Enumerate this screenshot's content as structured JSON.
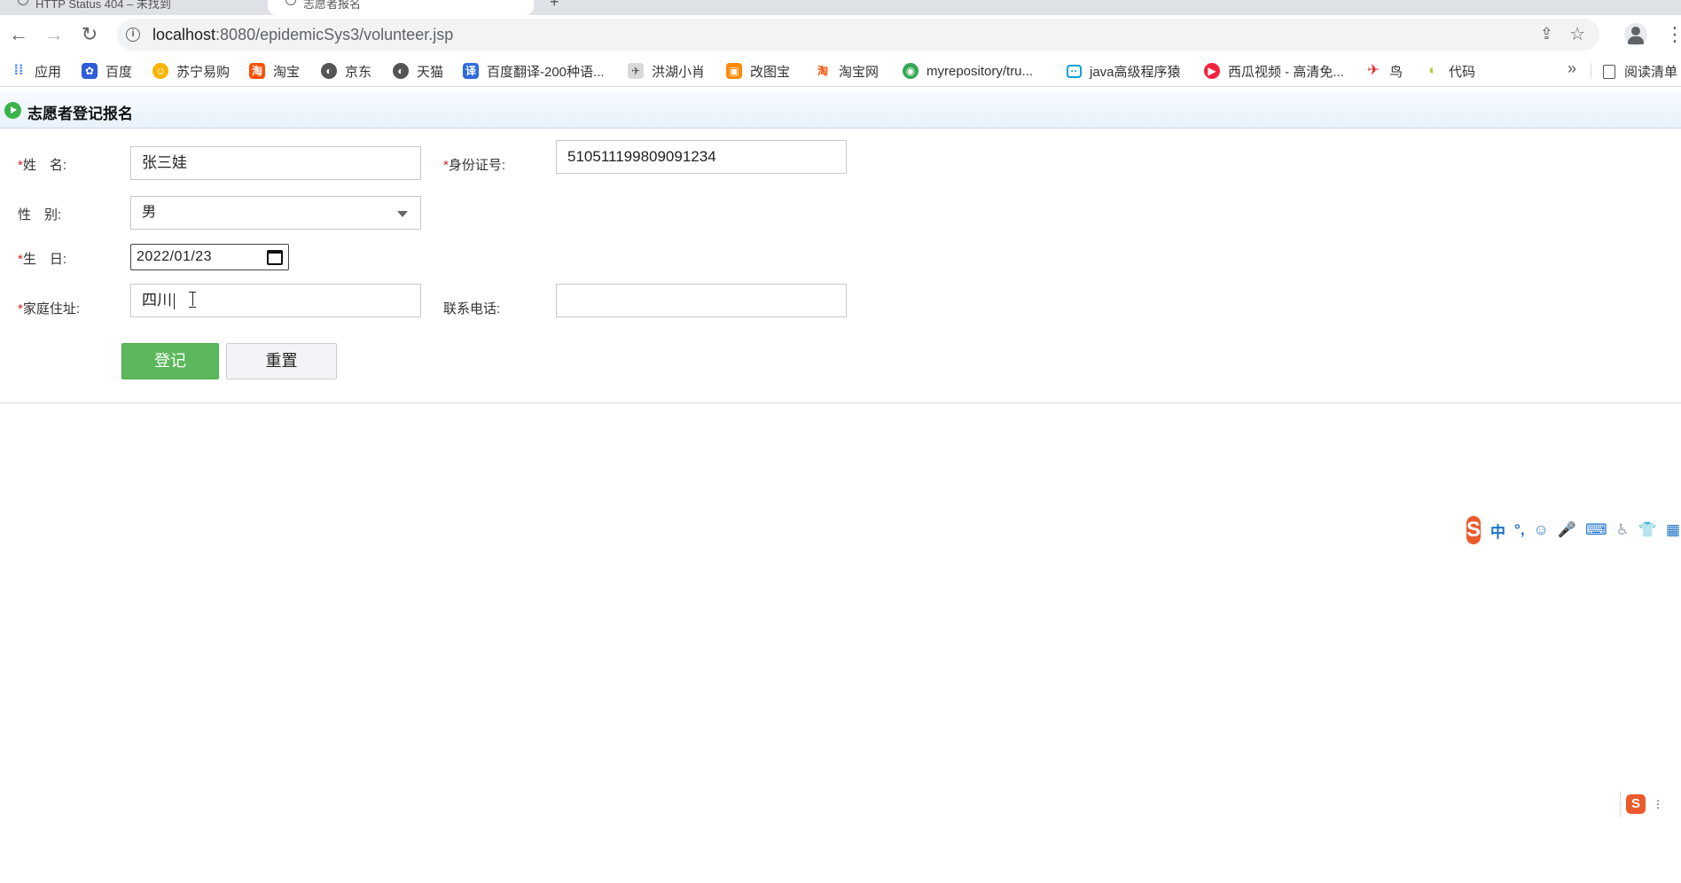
{
  "browser": {
    "url_host": "localhost",
    "url_rest": ":8080/epidemicSys3/volunteer.jsp",
    "tabs": [
      {
        "title": "HTTP Status 404 – 未找到"
      },
      {
        "title": "志愿者报名"
      }
    ],
    "bookmarks": [
      {
        "label": "应用",
        "icon": "apps-grid-icon",
        "color": "#4285f4"
      },
      {
        "label": "百度",
        "icon": "baidu-paw-icon",
        "color": "#2f5bd8"
      },
      {
        "label": "苏宁易购",
        "icon": "suning-icon",
        "color": "#f7b500"
      },
      {
        "label": "淘宝",
        "icon": "taobao-icon",
        "color": "#ff5000"
      },
      {
        "label": "京东",
        "icon": "globe-icon",
        "color": "#555555"
      },
      {
        "label": "天猫",
        "icon": "globe-icon",
        "color": "#555555"
      },
      {
        "label": "百度翻译-200种语...",
        "icon": "translate-icon",
        "color": "#2f6bdf"
      },
      {
        "label": "洪湖小肖",
        "icon": "bee-icon",
        "color": "#888888"
      },
      {
        "label": "改图宝",
        "icon": "gaitubao-icon",
        "color": "#ff8a00"
      },
      {
        "label": "淘宝网",
        "icon": "taobao-icon",
        "color": "#ff5000"
      },
      {
        "label": "myrepository/tru...",
        "icon": "chrome-icon",
        "color": "#34a853"
      },
      {
        "label": "java高级程序猿",
        "icon": "bilibili-icon",
        "color": "#00a1d6"
      },
      {
        "label": "西瓜视频 - 高清免...",
        "icon": "xigua-icon",
        "color": "#f0243c"
      },
      {
        "label": "鸟",
        "icon": "bird-icon",
        "color": "#e8262b"
      },
      {
        "label": "代码",
        "icon": "code-icon",
        "color": "#c6c84a"
      }
    ],
    "bookmarks_more": "»",
    "reading_list": "阅读清单"
  },
  "page": {
    "title": "志愿者登记报名",
    "form": {
      "required_mark": "*",
      "name": {
        "label": "姓　名:",
        "value": "张三娃"
      },
      "id_number": {
        "label": "身份证号:",
        "value": "510511199809091234"
      },
      "gender": {
        "label": "性　别:",
        "value": "男"
      },
      "birthday": {
        "label": "生　日:",
        "value": "2022/01/23"
      },
      "address": {
        "label": "家庭住址:",
        "value": "四川"
      },
      "phone": {
        "label": "联系电话:",
        "value": ""
      },
      "submit_label": "登记",
      "reset_label": "重置"
    }
  },
  "ime": {
    "logo": "S",
    "items": [
      "中",
      "°,",
      "☺",
      "🎤",
      "⌨",
      "♿",
      "👕",
      "▦"
    ],
    "mini_more": "⋮"
  }
}
